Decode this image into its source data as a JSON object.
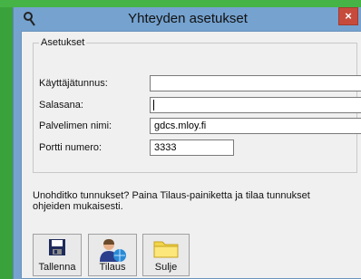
{
  "window": {
    "title": "Yhteyden asetukset",
    "close_glyph": "×",
    "title_icon": "wrench-icon"
  },
  "settings": {
    "legend": "Asetukset",
    "username": {
      "label": "Käyttäjätunnus:",
      "value": ""
    },
    "password": {
      "label": "Salasana:",
      "value": ""
    },
    "server": {
      "label": "Palvelimen nimi:",
      "value": "gdcs.mloy.fi"
    },
    "port": {
      "label": "Portti numero:",
      "value": "3333"
    }
  },
  "info_text": "Unohditko tunnukset? Paina Tilaus-painiketta ja tilaa tunnukset ohjeiden mukaisesti.",
  "buttons": {
    "save": {
      "label": "Tallenna",
      "icon": "floppy-disk-icon"
    },
    "order": {
      "label": "Tilaus",
      "icon": "user-globe-icon"
    },
    "close": {
      "label": "Sulje",
      "icon": "folder-icon"
    }
  },
  "colors": {
    "titlebar": "#75a2cf",
    "close_button": "#c74b3c",
    "client_bg": "#f0f0f0",
    "background": "#3aa23a"
  }
}
